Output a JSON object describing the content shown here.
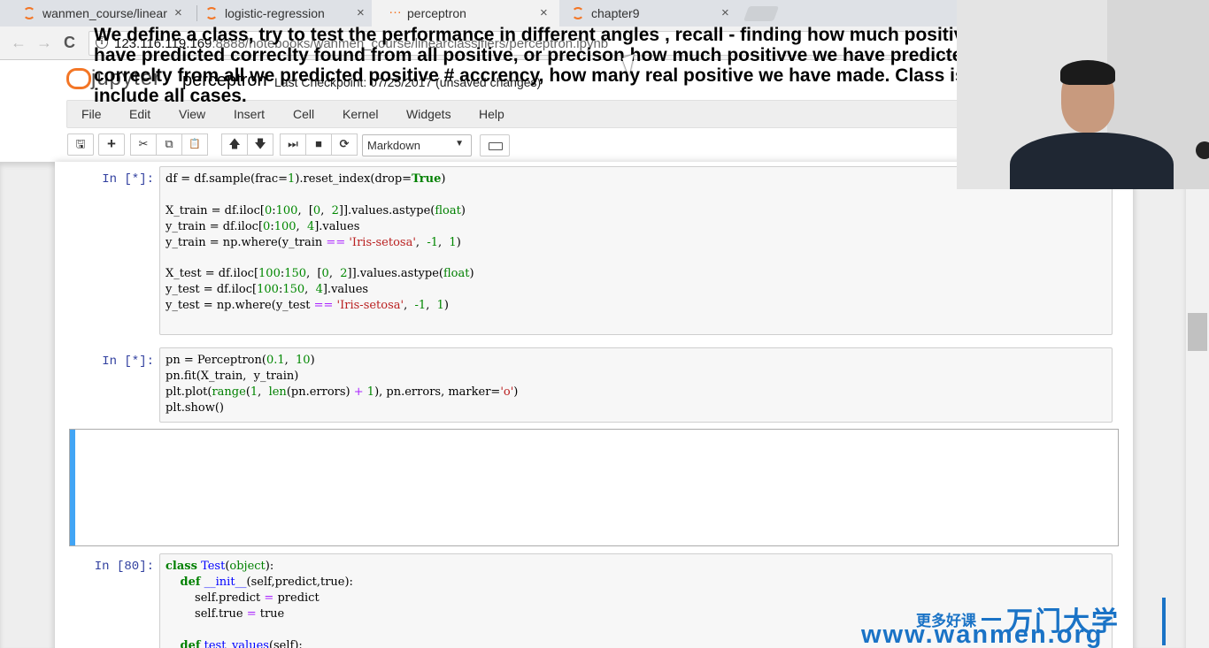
{
  "browser": {
    "tabs": [
      {
        "label": "wanmen_course/linear",
        "close": "×"
      },
      {
        "label": "logistic-regression",
        "close": "×"
      },
      {
        "label": "perceptron",
        "close": "×"
      },
      {
        "label": "chapter9",
        "close": "×"
      }
    ],
    "url_host": "123.116.119.169",
    "url_rest": ":8888/notebooks/wanmen_course/linearclassifiers/perceptron.ipynb",
    "icons": {
      "back": "←",
      "forward": "→",
      "reload": "C",
      "info": "i"
    }
  },
  "jupyter": {
    "logo_text": "jupyter",
    "notebook_name": "perceptron",
    "checkpoint": "Last Checkpoint: 07/25/2017 (unsaved changes)",
    "menu": [
      "File",
      "Edit",
      "View",
      "Insert",
      "Cell",
      "Kernel",
      "Widgets",
      "Help"
    ],
    "cell_type": "Markdown",
    "cell_type_caret": "▼",
    "toolbar_icons": {
      "save": "🖫",
      "add": "+",
      "cut": "✂",
      "copy": "⧉",
      "paste": "📋",
      "up": "🡅",
      "down": "🡇",
      "run": "⏭",
      "stop": "■",
      "restart": "⟳"
    }
  },
  "cells": [
    {
      "prompt": "In  [*]:"
    },
    {
      "prompt": "In  [*]:"
    },
    {
      "markdown": "We define a class, try to test the performance in different angles , recall - finding how much positive we have predicted correclty found from all positive, or precison how much positivve we have predicted correclty from all we predicted positive # accrency, how many real positive we have made. Class is used to include all cases."
    },
    {
      "prompt": "In  [80]:"
    }
  ],
  "code": {
    "c1": [
      [
        "df = df.sample(frac=",
        "1",
        ").reset_index(drop=",
        "True",
        ")"
      ],
      [
        "X_train = df.iloc[",
        "0",
        ":",
        "100",
        ",  [",
        "0",
        ",  ",
        "2",
        "]].values.astype(",
        "float",
        ")"
      ],
      [
        "y_train = df.iloc[",
        "0",
        ":",
        "100",
        ",  ",
        "4",
        "].values"
      ],
      [
        "y_train = np.where(y_train ",
        "==",
        " ",
        "'Iris-setosa'",
        ",  ",
        "-1",
        ",  ",
        "1",
        ")"
      ],
      [
        "X_test = df.iloc[",
        "100",
        ":",
        "150",
        ",  [",
        "0",
        ",  ",
        "2",
        "]].values.astype(",
        "float",
        ")"
      ],
      [
        "y_test = df.iloc[",
        "100",
        ":",
        "150",
        ",  ",
        "4",
        "].values"
      ],
      [
        "y_test = np.where(y_test ",
        "==",
        " ",
        "'Iris-setosa'",
        ",  ",
        "-1",
        ",  ",
        "1",
        ")"
      ]
    ],
    "c2": [
      [
        "pn = Perceptron(",
        "0.1",
        ",  ",
        "10",
        ")"
      ],
      [
        "pn.fit(X_train,  y_train)"
      ],
      [
        "plt.plot(",
        "range",
        "(",
        "1",
        ",  ",
        "len",
        "(pn.errors) ",
        "+",
        " ",
        "1",
        "), pn.errors, marker=",
        "'o'",
        ")"
      ],
      [
        "plt.show()"
      ]
    ],
    "c3": [
      [
        "class",
        " ",
        "Test",
        "(",
        "object",
        "):"
      ],
      [
        "    ",
        "def",
        " ",
        "__init__",
        "(self,predict,true):"
      ],
      [
        "        self.predict ",
        "=",
        " predict"
      ],
      [
        "        self.true ",
        "=",
        " true"
      ],
      [
        "    ",
        "def",
        " ",
        "test_values",
        "(self):"
      ]
    ]
  },
  "watermark": {
    "tagline": "更多好课",
    "brand": "万门大学",
    "url": "www.wanmen.org"
  },
  "colors": {
    "jupyter_orange": "#f37626",
    "prompt_blue": "#303f9f",
    "selected_cell_bar": "#42a5f5",
    "watermark_blue": "#1a73c6"
  }
}
